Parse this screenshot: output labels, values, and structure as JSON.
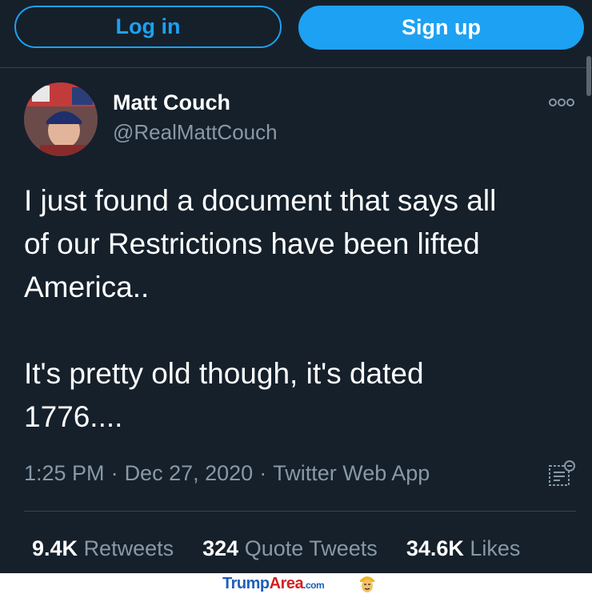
{
  "header": {
    "login_label": "Log in",
    "signup_label": "Sign up"
  },
  "tweet": {
    "author_name": "Matt Couch",
    "author_handle": "@RealMattCouch",
    "text": "I just found a document that says all\nof our Restrictions have been lifted\nAmerica..\n\nIt's pretty old though, it's dated\n1776....",
    "time": "1:25 PM",
    "date": "Dec 27, 2020",
    "source": "Twitter Web App",
    "separator": "·",
    "stats": {
      "retweets_count": "9.4K",
      "retweets_label": "Retweets",
      "quotes_count": "324",
      "quotes_label": "Quote Tweets",
      "likes_count": "34.6K",
      "likes_label": "Likes"
    }
  },
  "icons": {
    "more": "more-options-icon",
    "analytics": "tweet-analytics-icon"
  },
  "watermark": {
    "brand_part1": "Trump",
    "brand_part2": "Area",
    "suffix": ".com"
  },
  "colors": {
    "background": "#15202b",
    "accent": "#1da1f2",
    "secondary_text": "#8899a6",
    "divider": "#38444d"
  }
}
